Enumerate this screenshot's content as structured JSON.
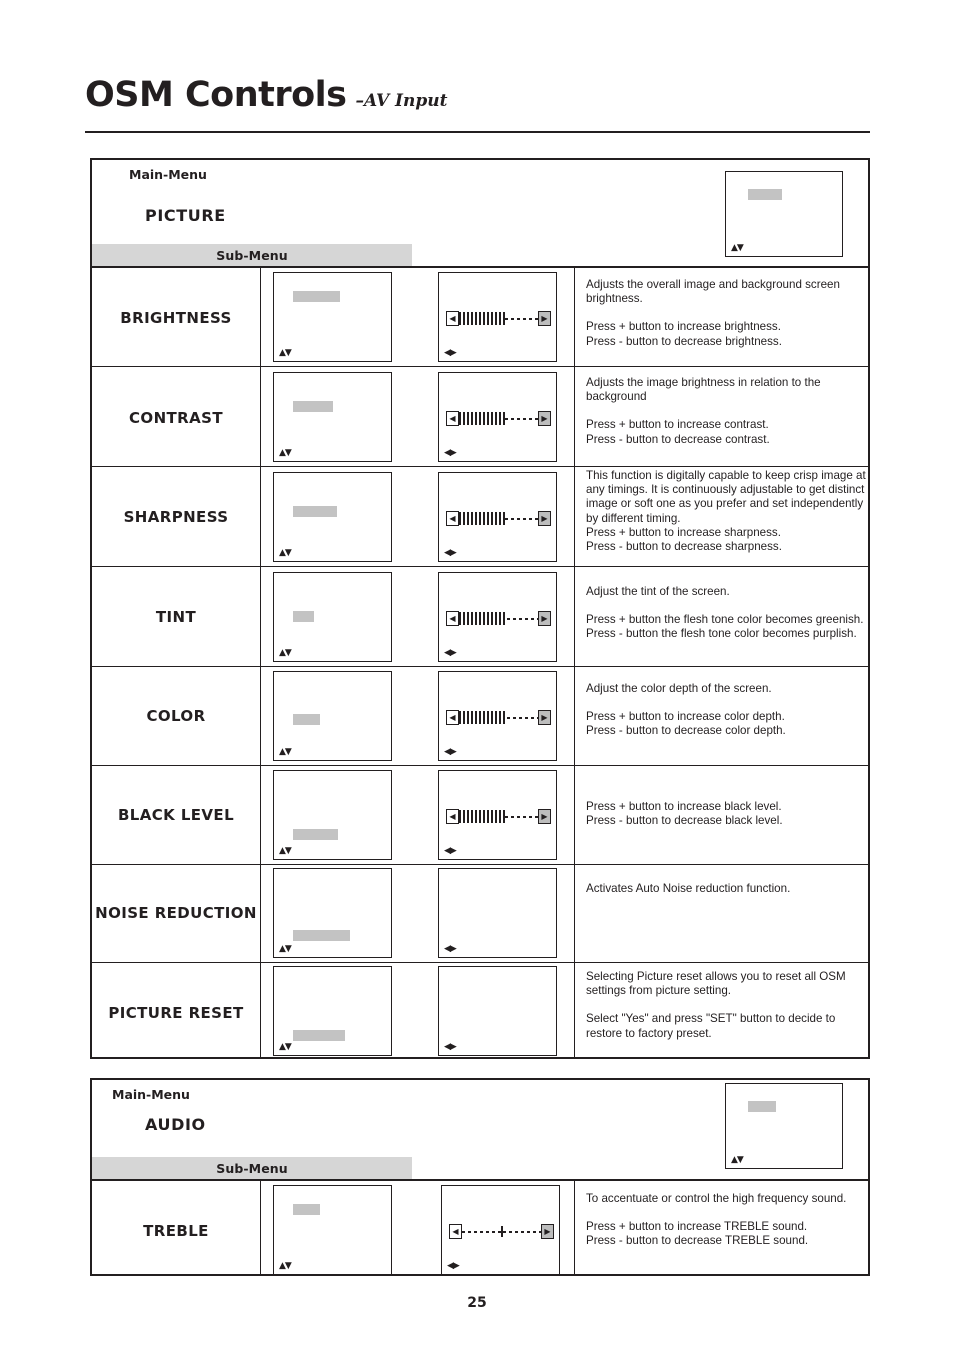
{
  "header": {
    "title": "OSM Controls",
    "subtitle": "–AV Input",
    "page_number": "25"
  },
  "labels": {
    "main_menu": "Main-Menu",
    "sub_menu": "Sub-Menu"
  },
  "sections": [
    {
      "main_menu_title": "PICTURE",
      "rows": [
        {
          "label": "BRIGHTNESS",
          "desc": [
            "Adjusts the overall image and background screen brightness.",
            "Press + button to increase brightness.",
            "Press - button to decrease brightness."
          ]
        },
        {
          "label": "CONTRAST",
          "desc": [
            "Adjusts the image brightness in relation to the background",
            "Press + button to increase contrast.",
            "Press - button to decrease contrast."
          ]
        },
        {
          "label": "SHARPNESS",
          "desc": [
            "This function is digitally capable to keep crisp image at any timings.  It is continuously adjustable to get distinct image or soft one as you prefer and set independently by different timing.",
            "Press + button to increase sharpness.",
            "Press - button to decrease sharpness."
          ]
        },
        {
          "label": "TINT",
          "desc": [
            "Adjust the tint of the screen.",
            "Press + button the flesh tone color becomes greenish.",
            "Press - button the flesh tone color becomes purplish."
          ]
        },
        {
          "label": "COLOR",
          "desc": [
            "Adjust the color depth of the screen.",
            "Press + button to increase color depth.",
            "Press - button to decrease color depth."
          ]
        },
        {
          "label": "BLACK LEVEL",
          "desc": [
            "Press + button to increase black level.",
            "Press - button to decrease black level."
          ]
        },
        {
          "label": "NOISE REDUCTION",
          "desc": [
            "Activates Auto Noise reduction function."
          ]
        },
        {
          "label": "PICTURE RESET",
          "desc": [
            "Selecting Picture reset allows you to reset all OSM settings from picture setting.",
            "Select \"Yes\" and press \"SET\" button to decide to restore to factory preset."
          ]
        }
      ]
    },
    {
      "main_menu_title": "AUDIO",
      "rows": [
        {
          "label": "TREBLE",
          "desc": [
            "To accentuate or control the high frequency sound.",
            "Press + button to increase TREBLE sound.",
            "Press - button to decrease TREBLE sound."
          ]
        }
      ]
    }
  ],
  "icons": {
    "up_down": "▲▼",
    "left_right": "◀▶",
    "slider_left": "◀",
    "slider_right": "▶"
  },
  "colors": {
    "ink": "#231f20",
    "band": "#d6d6d6",
    "highlight": "#c3c3c3"
  }
}
